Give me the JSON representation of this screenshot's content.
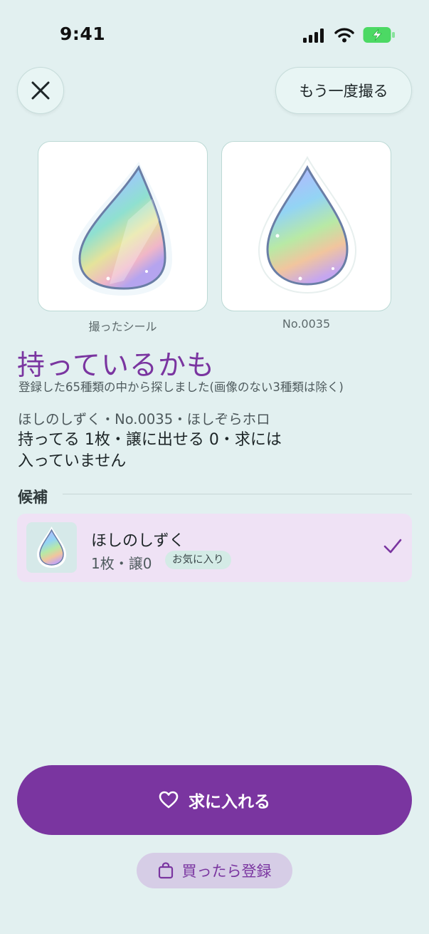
{
  "status_bar": {
    "time": "9:41"
  },
  "header": {
    "retake_label": "もう一度撮る"
  },
  "compare": {
    "photo_caption": "撮ったシール",
    "match_caption": "No.0035"
  },
  "result": {
    "headline": "持っているかも",
    "note": "登録した65種類の中から探しました(画像のない3種類は除く)",
    "meta": "ほしのしずく・No.0035・ほしぞらホロ",
    "status": "持ってる 1枚・譲に出せる 0・求には入っていません"
  },
  "candidates": {
    "section_title": "候補",
    "items": [
      {
        "name": "ほしのしずく",
        "counts": "1枚・譲0",
        "tag": "お気に入り",
        "selected": true
      }
    ]
  },
  "actions": {
    "primary_label": "求に入れる",
    "secondary_label": "買ったら登録"
  },
  "colors": {
    "accent": "#7a35a0",
    "background": "#e2f0f0",
    "candidate_bg": "#efe2f5",
    "battery": "#4cd964"
  },
  "icons": [
    "close-icon",
    "heart-icon",
    "bag-icon",
    "check-icon",
    "signal-icon",
    "wifi-icon",
    "battery-icon"
  ]
}
